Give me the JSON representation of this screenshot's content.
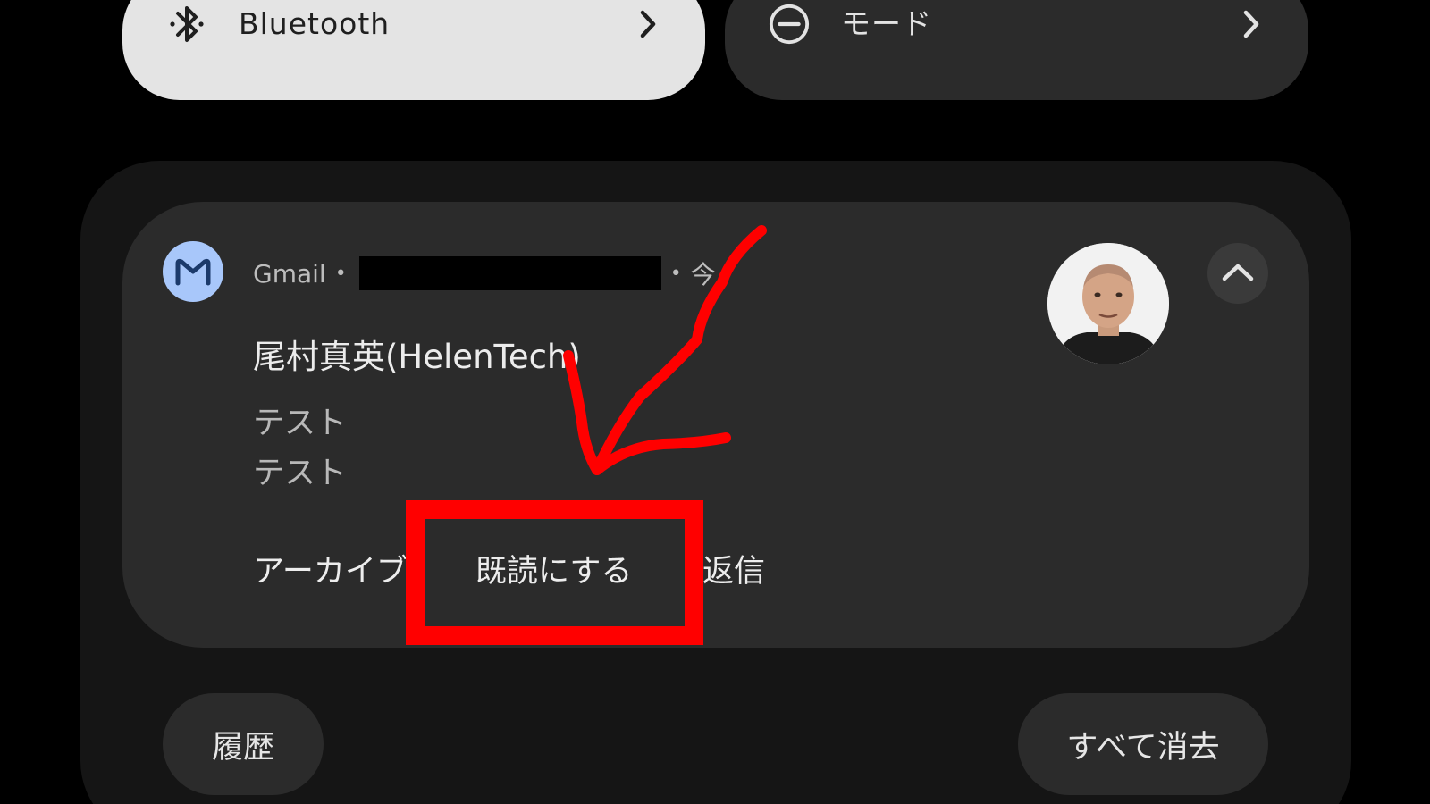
{
  "quick_settings": {
    "bluetooth": {
      "label": "Bluetooth",
      "icon": "bluetooth-icon",
      "state": "on"
    },
    "mode": {
      "label": "モード",
      "icon": "do-not-disturb-icon",
      "state": "off"
    }
  },
  "notification": {
    "app_name": "Gmail",
    "separator": "•",
    "time": "今",
    "sender": "尾村真英(HelenTech)",
    "body_lines": [
      "テスト",
      "テスト"
    ],
    "actions": {
      "archive": "アーカイブ",
      "mark_read": "既読にする",
      "reply": "返信"
    }
  },
  "footer": {
    "history": "履歴",
    "clear_all": "すべて消去"
  },
  "colors": {
    "background": "#000000",
    "tile_active": "#e4e4e4",
    "tile_inactive": "#2b2b2b",
    "card": "#2b2b2b",
    "gmail_icon_bg": "#a8c7fa",
    "annotation": "#ff0000"
  }
}
